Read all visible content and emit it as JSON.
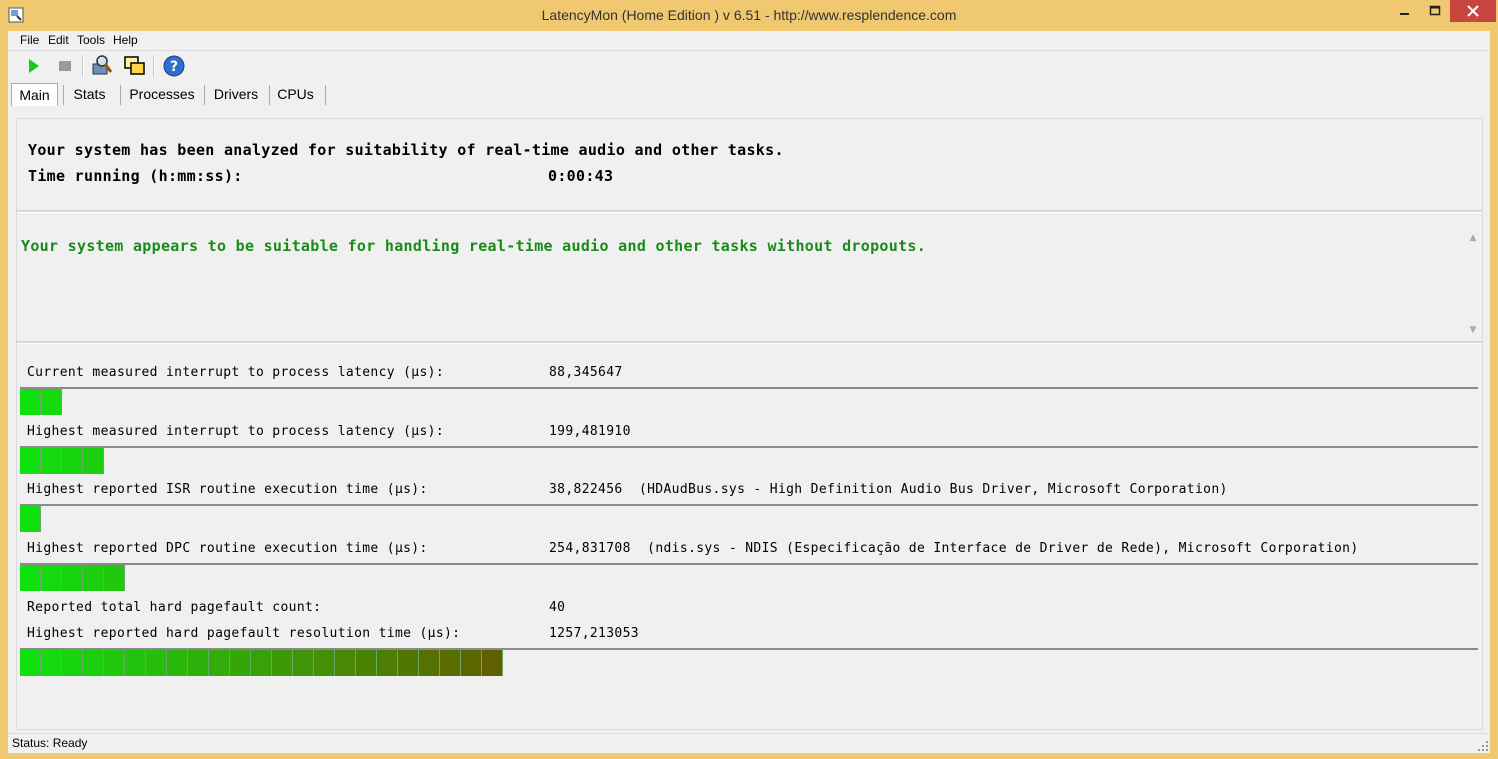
{
  "window": {
    "title": "LatencyMon  (Home Edition )  v 6.51 - http://www.resplendence.com"
  },
  "menu": [
    "File",
    "Edit",
    "Tools",
    "Help"
  ],
  "toolbar": {
    "icons": [
      "play-icon",
      "stop-icon",
      "analyze-icon",
      "windows-icon",
      "help-icon"
    ]
  },
  "tabs": [
    {
      "label": "Main",
      "active": true
    },
    {
      "label": "Stats",
      "active": false
    },
    {
      "label": "Processes",
      "active": false
    },
    {
      "label": "Drivers",
      "active": false
    },
    {
      "label": "CPUs",
      "active": false
    }
  ],
  "main": {
    "analyzed_text": "Your system has been analyzed for suitability of real-time audio and other tasks.",
    "time_label": "Time running (h:mm:ss):",
    "time_value": "0:00:43",
    "verdict": "Your system appears to be suitable for handling real-time audio and other tasks without dropouts.",
    "verdict_color": "#1a8a1a"
  },
  "metrics": [
    {
      "label": "Current measured interrupt to process latency (µs):",
      "value": "88,345647",
      "detail": "",
      "bar_segments": 2
    },
    {
      "label": "Highest measured interrupt to process latency (µs):",
      "value": "199,481910",
      "detail": "",
      "bar_segments": 4
    },
    {
      "label": "Highest reported ISR routine execution time (µs):",
      "value": "38,822456",
      "detail": "(HDAudBus.sys - High Definition Audio Bus Driver, Microsoft Corporation)",
      "bar_segments": 1
    },
    {
      "label": "Highest reported DPC routine execution time (µs):",
      "value": "254,831708",
      "detail": "(ndis.sys - NDIS (Especificação de Interface de Driver de Rede), Microsoft Corporation)",
      "bar_segments": 5
    },
    {
      "label": "Reported total hard pagefault count:",
      "value": "40",
      "detail": ""
    },
    {
      "label": "Highest reported hard pagefault resolution time (µs):",
      "value": "1257,213053",
      "detail": "",
      "bar_segments": 23
    }
  ],
  "status": {
    "text": "Status: Ready"
  }
}
